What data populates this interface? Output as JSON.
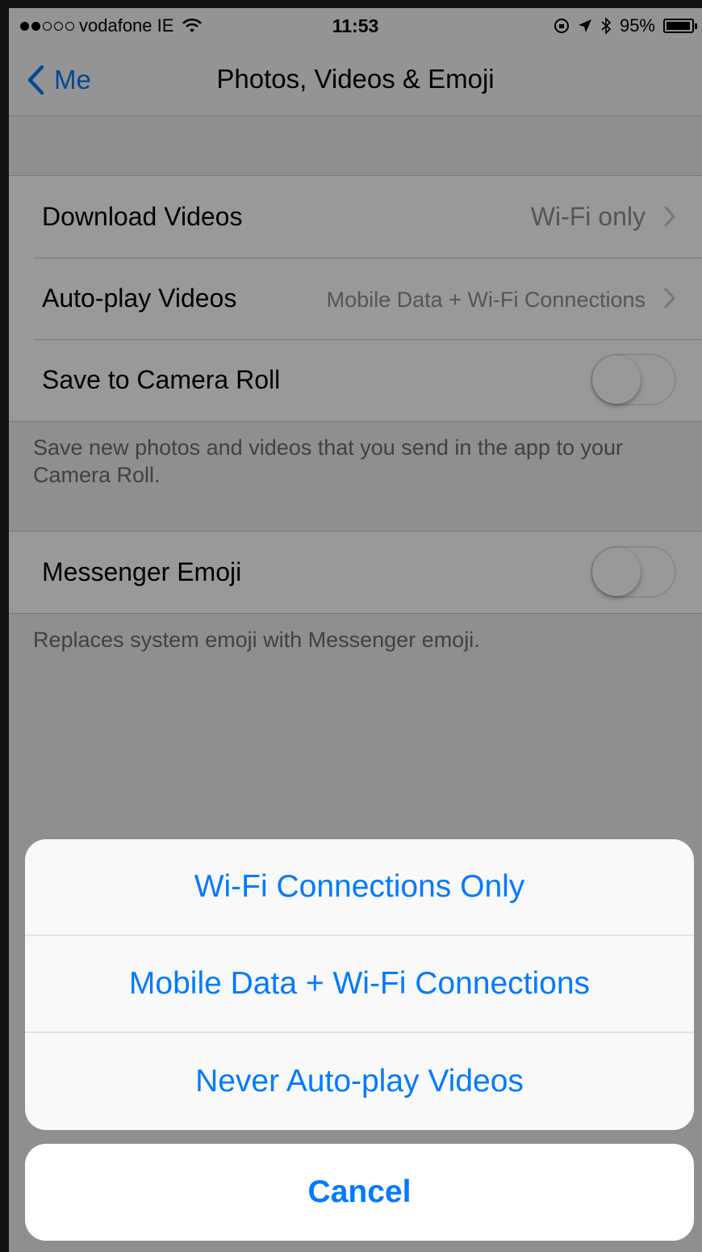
{
  "status_bar": {
    "carrier": "vodafone IE",
    "time": "11:53",
    "battery": "95%",
    "battery_level": 0.95,
    "signal_bars_filled": 2,
    "signal_bars_total": 5
  },
  "nav": {
    "back_label": "Me",
    "title": "Photos, Videos & Emoji"
  },
  "settings": {
    "download_videos": {
      "label": "Download Videos",
      "value": "Wi-Fi only"
    },
    "autoplay_videos": {
      "label": "Auto-play Videos",
      "value": "Mobile Data + Wi-Fi Connections"
    },
    "save_camera_roll": {
      "label": "Save to Camera Roll",
      "enabled": false
    },
    "save_footnote": "Save new photos and videos that you send in the app to your Camera Roll.",
    "messenger_emoji": {
      "label": "Messenger Emoji",
      "enabled": false
    },
    "emoji_footnote": "Replaces system emoji with Messenger emoji."
  },
  "action_sheet": {
    "options": [
      "Wi-Fi Connections Only",
      "Mobile Data + Wi-Fi Connections",
      "Never Auto-play Videos"
    ],
    "cancel_label": "Cancel"
  },
  "colors": {
    "accent": "#007aff",
    "background": "#efeff4",
    "secondary_text": "#8e8e93"
  }
}
